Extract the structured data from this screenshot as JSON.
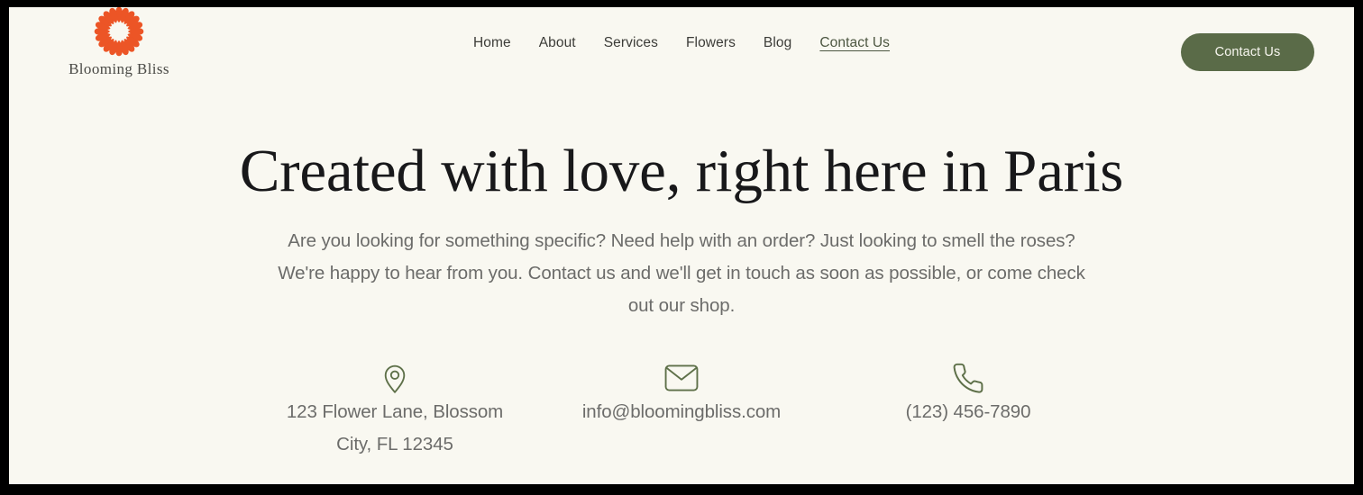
{
  "theme": {
    "page_background": "#f9f8f1",
    "frame_color": "#000000",
    "brand_orange": "#ec5526",
    "accent_green": "#5a6b48",
    "icon_green": "#5e7049",
    "body_text": "#6c6c6a",
    "heading_text": "#18181a"
  },
  "header": {
    "logo_icon": "flower-sunburst-icon",
    "brand_name": "Blooming Bliss",
    "nav": [
      {
        "label": "Home",
        "active": false
      },
      {
        "label": "About",
        "active": false
      },
      {
        "label": "Services",
        "active": false
      },
      {
        "label": "Flowers",
        "active": false
      },
      {
        "label": "Blog",
        "active": false
      },
      {
        "label": "Contact Us",
        "active": true
      }
    ],
    "cta_label": "Contact Us"
  },
  "hero": {
    "title": "Created with love, right here in Paris",
    "paragraph_lines": [
      "Are you looking for something specific? Need help with an order? Just looking to smell the roses?",
      "We're happy to hear from you. Contact us and we'll get in touch as soon as possible, or come",
      "check out our shop."
    ]
  },
  "contact": {
    "items": [
      {
        "icon": "map-pin-icon",
        "lines": [
          "123 Flower Lane, Blossom",
          "City, FL 12345"
        ]
      },
      {
        "icon": "envelope-icon",
        "lines": [
          "info@bloomingbliss.com"
        ]
      },
      {
        "icon": "phone-icon",
        "lines": [
          "(123) 456-7890"
        ]
      }
    ]
  }
}
